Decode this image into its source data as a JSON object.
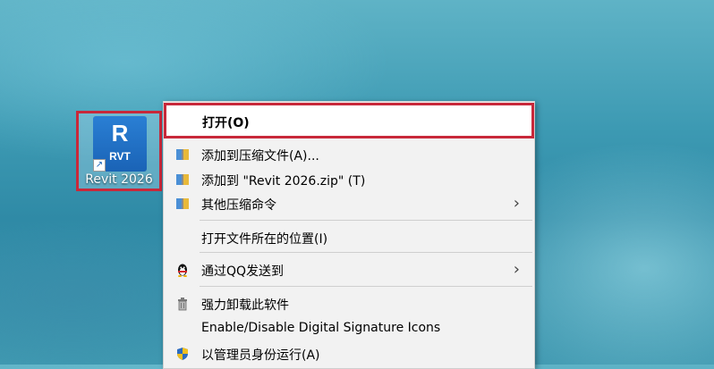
{
  "desktop_icon": {
    "tile_letter": "R",
    "tile_sub": "RVT",
    "caption": "Revit 2026"
  },
  "menu": {
    "items": [
      {
        "label": "打开(O)",
        "icon": "",
        "submenu": false
      },
      {
        "label": "添加到压缩文件(A)...",
        "icon": "archive-icon",
        "submenu": false
      },
      {
        "label": "添加到 \"Revit 2026.zip\" (T)",
        "icon": "archive-icon",
        "submenu": false
      },
      {
        "label": "其他压缩命令",
        "icon": "archive-icon",
        "submenu": true
      },
      {
        "label": "打开文件所在的位置(I)",
        "icon": "",
        "submenu": false
      },
      {
        "label": "通过QQ发送到",
        "icon": "qq-penguin-icon",
        "submenu": true
      },
      {
        "label": "强力卸载此软件",
        "icon": "trash-icon",
        "submenu": false
      },
      {
        "label": "Enable/Disable Digital Signature Icons",
        "icon": "",
        "submenu": false
      },
      {
        "label": "以管理员身份运行(A)",
        "icon": "uac-shield-icon",
        "submenu": false
      }
    ]
  },
  "colors": {
    "highlight_border": "#c8283a",
    "revit_blue": "#1a63b6"
  }
}
